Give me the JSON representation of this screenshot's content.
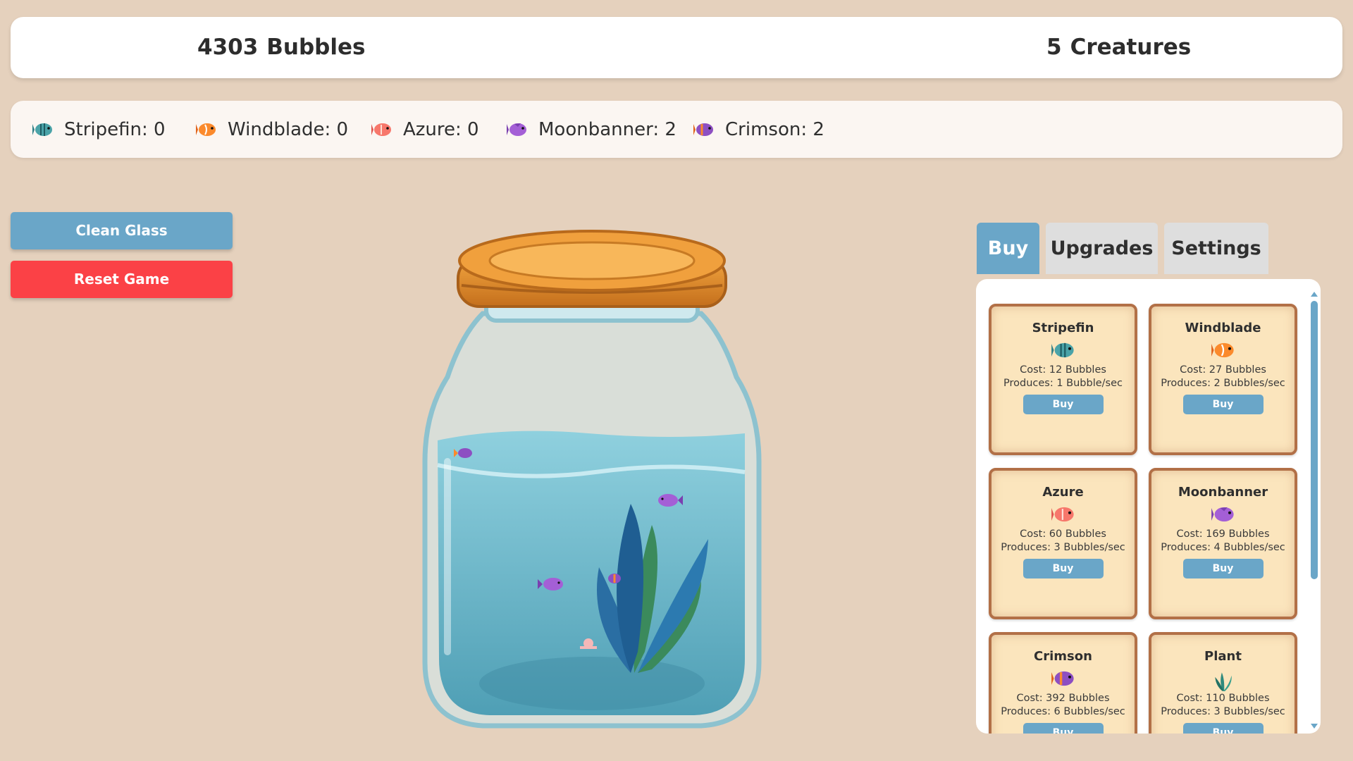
{
  "stats": {
    "bubbles_value": "4303",
    "bubbles_label": "Bubbles",
    "creatures_value": "5",
    "creatures_label": "Creatures"
  },
  "counts": [
    {
      "text": "Stripefin: 0",
      "icon": "teal-fish-icon"
    },
    {
      "text": "Windblade: 0",
      "icon": "orange-fish-icon"
    },
    {
      "text": "Azure: 0",
      "icon": "salmon-fish-icon"
    },
    {
      "text": "Moonbanner: 2",
      "icon": "purple-fish-icon"
    },
    {
      "text": "Crimson: 2",
      "icon": "crimson-fish-icon"
    }
  ],
  "actions": {
    "clean_label": "Clean Glass",
    "reset_label": "Reset Game"
  },
  "tabs": {
    "buy": "Buy",
    "upgrades": "Upgrades",
    "settings": "Settings",
    "active": "Buy"
  },
  "shop": [
    {
      "name": "Stripefin",
      "cost": "Cost: 12 Bubbles",
      "produces": "Produces: 1 Bubble/sec",
      "button": "Buy",
      "icon": "teal-fish-icon"
    },
    {
      "name": "Windblade",
      "cost": "Cost: 27 Bubbles",
      "produces": "Produces: 2 Bubbles/sec",
      "button": "Buy",
      "icon": "orange-fish-icon"
    },
    {
      "name": "Azure",
      "cost": "Cost: 60 Bubbles",
      "produces": "Produces: 3 Bubbles/sec",
      "button": "Buy",
      "icon": "salmon-fish-icon"
    },
    {
      "name": "Moonbanner",
      "cost": "Cost: 169 Bubbles",
      "produces": "Produces: 4 Bubbles/sec",
      "button": "Buy",
      "icon": "purple-fish-icon"
    },
    {
      "name": "Crimson",
      "cost": "Cost: 392 Bubbles",
      "produces": "Produces: 6 Bubbles/sec",
      "button": "Buy",
      "icon": "crimson-fish-icon"
    },
    {
      "name": "Plant",
      "cost": "Cost: 110 Bubbles",
      "produces": "Produces: 3 Bubbles/sec",
      "button": "Buy",
      "icon": "seaweed-icon"
    }
  ],
  "colors": {
    "background": "#e5d1bd",
    "accent_blue": "#6aa6c8",
    "reset_red": "#fb4146",
    "card_bg": "#fbe5bd",
    "card_border": "#b27047"
  }
}
